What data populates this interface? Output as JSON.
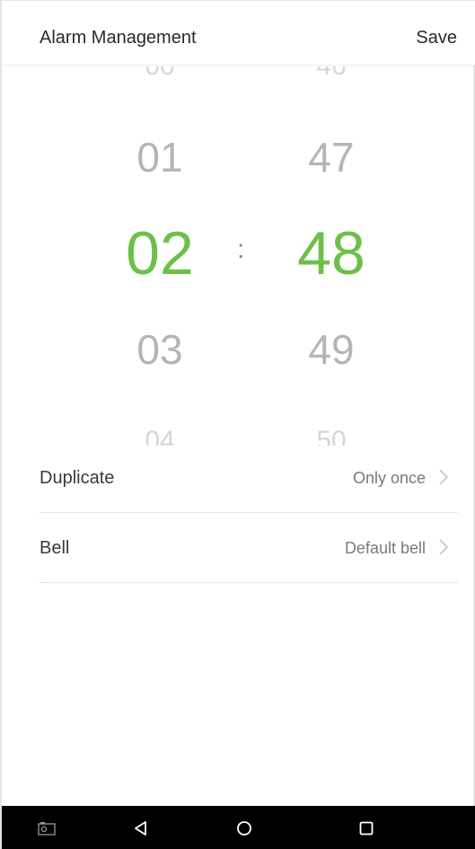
{
  "header": {
    "title": "Alarm Management",
    "save_label": "Save"
  },
  "picker": {
    "hours": {
      "above_far": "00",
      "above": "01",
      "selected": "02",
      "below": "03",
      "below_far": "04"
    },
    "minutes": {
      "above_far": "46",
      "above": "47",
      "selected": "48",
      "below": "49",
      "below_far": "50"
    },
    "separator": ":"
  },
  "settings": [
    {
      "label": "Duplicate",
      "value": "Only once"
    },
    {
      "label": "Bell",
      "value": "Default bell"
    }
  ],
  "colors": {
    "accent": "#6cc04a",
    "navbar": "#000000"
  },
  "navbar": {
    "icons": [
      "screenshot-icon",
      "back-icon",
      "home-icon",
      "recents-icon"
    ]
  }
}
